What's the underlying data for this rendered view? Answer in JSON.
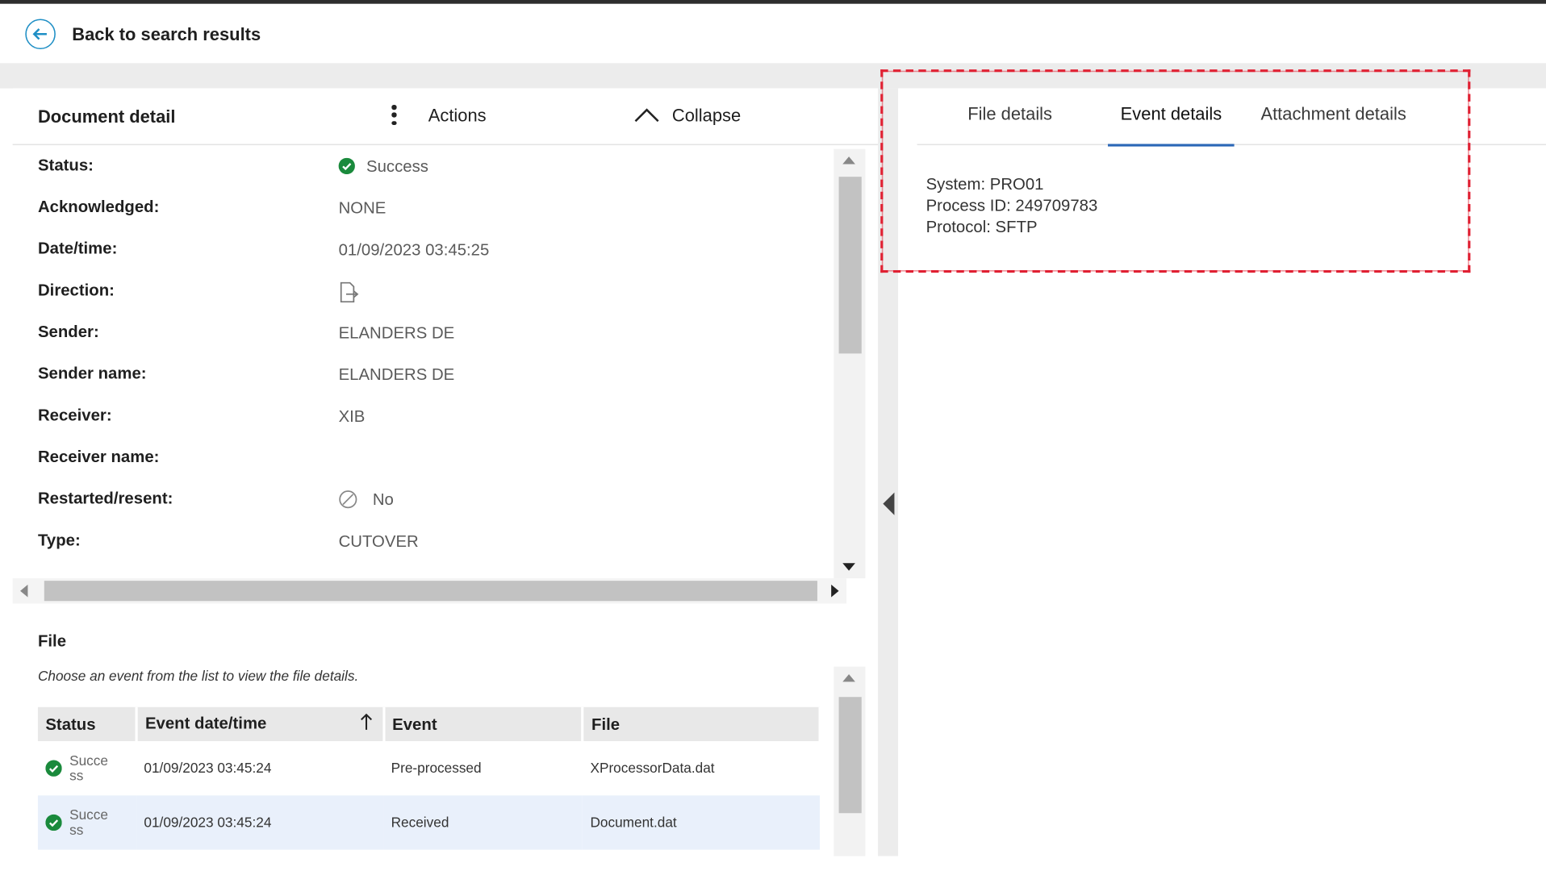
{
  "nav": {
    "back_label": "Back to search results"
  },
  "detail": {
    "title": "Document detail",
    "actions_label": "Actions",
    "collapse_label": "Collapse",
    "properties": [
      {
        "label": "Status:",
        "value": "Success",
        "icon": "success-check-icon"
      },
      {
        "label": "Acknowledged:",
        "value": "NONE"
      },
      {
        "label": "Date/time:",
        "value": "01/09/2023 03:45:25"
      },
      {
        "label": "Direction:",
        "value": "",
        "icon": "document-inbound-icon"
      },
      {
        "label": "Sender:",
        "value": "ELANDERS DE"
      },
      {
        "label": "Sender name:",
        "value": "ELANDERS DE"
      },
      {
        "label": "Receiver:",
        "value": "XIB"
      },
      {
        "label": "Receiver name:",
        "value": ""
      },
      {
        "label": "Restarted/resent:",
        "value": "No",
        "icon": "blocked-circle-icon"
      },
      {
        "label": "Type:",
        "value": "CUTOVER"
      }
    ]
  },
  "file_section": {
    "title": "File",
    "hint": "Choose an event from the list to view the file details.",
    "columns": [
      "Status",
      "Event date/time",
      "Event",
      "File"
    ],
    "rows": [
      {
        "status": "Success",
        "datetime": "01/09/2023 03:45:24",
        "event": "Pre-processed",
        "file": "XProcessorData.dat"
      },
      {
        "status": "Success",
        "datetime": "01/09/2023 03:45:24",
        "event": "Received",
        "file": "Document.dat"
      }
    ]
  },
  "right_tabs": {
    "items": [
      "File details",
      "Event details",
      "Attachment details"
    ],
    "active": "Event details"
  },
  "event_details": {
    "system": "System: PRO01",
    "process_id": "Process ID: 249709783",
    "protocol": "Protocol: SFTP"
  },
  "colors": {
    "accent": "#2b67b7",
    "success": "#1a8a3c",
    "highlight": "#e02133",
    "back_icon": "#1f8fc5"
  }
}
